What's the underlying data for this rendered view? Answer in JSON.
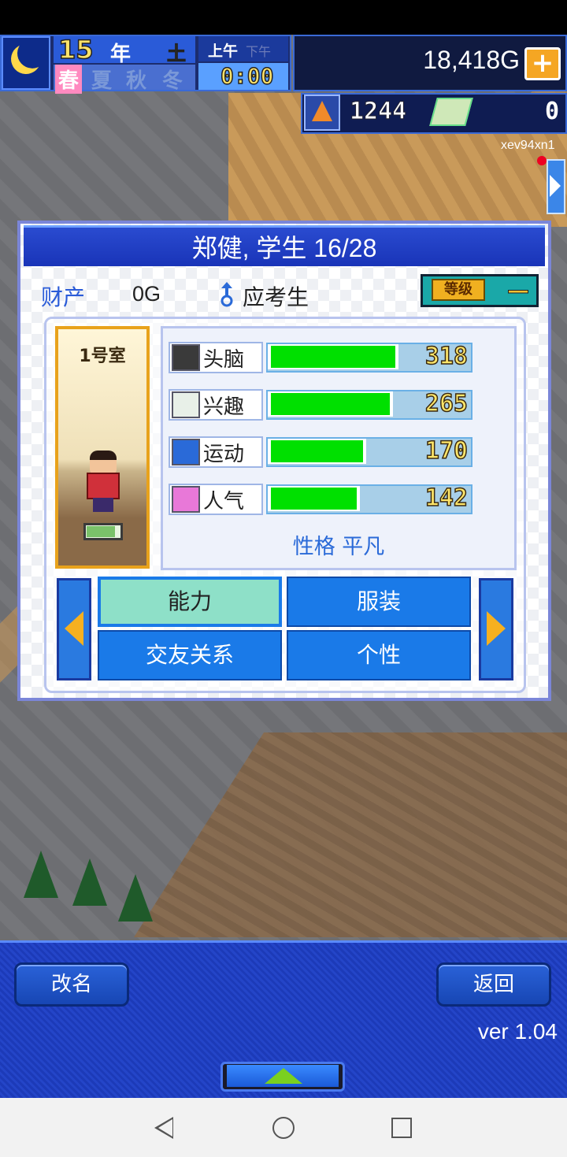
{
  "hud": {
    "year": "15",
    "year_label": "年",
    "weekday": "土",
    "am": "上午",
    "pm": "下午",
    "seasons": [
      "春",
      "夏",
      "秋",
      "冬"
    ],
    "active_season_index": 0,
    "time": "0:00",
    "money": "18,418G",
    "research_points": "1244",
    "tickets": "0",
    "user_id": "xev94xn1"
  },
  "dialog": {
    "title": "郑健, 学生 16/28",
    "asset_label": "财产",
    "asset_value": "0G",
    "role": "应考生",
    "level_label": "等级",
    "level_value": "—",
    "room": "1号室",
    "stats": [
      {
        "name": "头脑",
        "value": "318",
        "fill": 0.62,
        "icon": "brain-icon"
      },
      {
        "name": "兴趣",
        "value": "265",
        "fill": 0.59,
        "icon": "interest-icon"
      },
      {
        "name": "运动",
        "value": "170",
        "fill": 0.46,
        "icon": "sport-icon"
      },
      {
        "name": "人气",
        "value": "142",
        "fill": 0.43,
        "icon": "popularity-icon"
      }
    ],
    "personality": "性格 平凡",
    "tabs": [
      "能力",
      "服装",
      "交友关系",
      "个性"
    ],
    "active_tab": "能力"
  },
  "bottom": {
    "rename": "改名",
    "back": "返回",
    "version": "ver 1.04"
  },
  "colors": {
    "bar_fill": "#00e000",
    "accent_blue": "#1a7ae8",
    "active_tab": "#8ee0c8",
    "gold": "#ffe66a"
  }
}
